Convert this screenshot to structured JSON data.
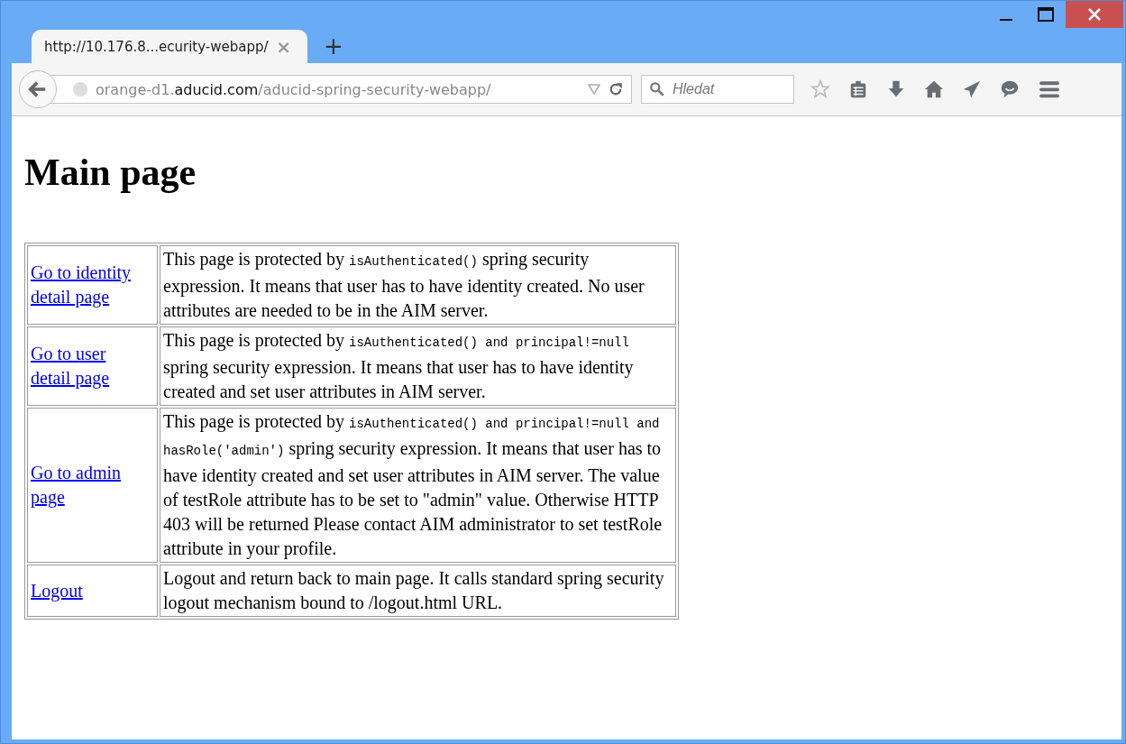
{
  "tab": {
    "title": "http://10.176.8...ecurity-webapp/",
    "close": "×"
  },
  "new_tab": "+",
  "address": {
    "prefix": "orange-d1.",
    "host": "aducid.com",
    "path": "/aducid-spring-security-webapp/"
  },
  "search": {
    "placeholder": "Hledat"
  },
  "page": {
    "heading": "Main page",
    "rows": [
      {
        "link": "Go to identity detail page",
        "description": [
          {
            "kind": "text",
            "text": "This page is protected by "
          },
          {
            "kind": "code",
            "text": "isAuthenticated()"
          },
          {
            "kind": "text",
            "text": " spring security expression. It means that user has to have identity created. No user attributes are needed to be in the AIM server."
          }
        ]
      },
      {
        "link": "Go to user detail page",
        "description": [
          {
            "kind": "text",
            "text": "This page is protected by "
          },
          {
            "kind": "code",
            "text": "isAuthenticated() and principal!=null"
          },
          {
            "kind": "text",
            "text": " spring security expression. It means that user has to have identity created and set user attributes in AIM server."
          }
        ]
      },
      {
        "link": "Go to admin page",
        "description": [
          {
            "kind": "text",
            "text": "This page is protected by "
          },
          {
            "kind": "code",
            "text": "isAuthenticated() and principal!=null and hasRole('admin')"
          },
          {
            "kind": "text",
            "text": " spring security expression. It means that user has to have identity created and set user attributes in AIM server. The value of testRole attribute has to be set to \"admin\" value. Otherwise HTTP 403 will be returned Please contact AIM administrator to set testRole attribute in your profile."
          }
        ]
      },
      {
        "link": "Logout",
        "description": [
          {
            "kind": "text",
            "text": "Logout and return back to main page. It calls standard spring security logout mechanism bound to /logout.html URL."
          }
        ]
      }
    ]
  }
}
